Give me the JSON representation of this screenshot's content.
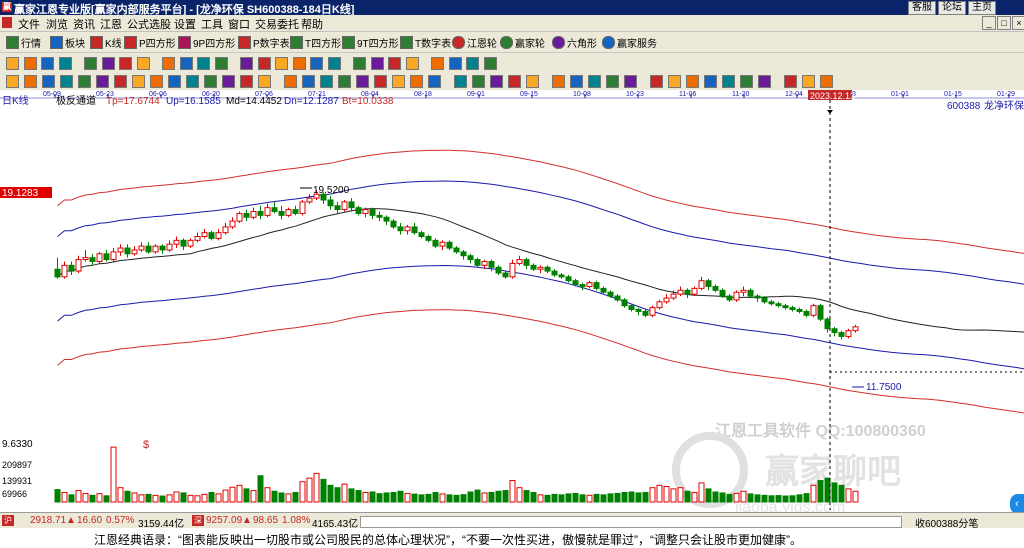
{
  "titlebar": {
    "title": "赢家江恩专业版[赢家内部服务平台] - [龙净环保   SH600388-184日K线]",
    "app_icon": "赢",
    "links": [
      "客服",
      "论坛",
      "主页"
    ],
    "window_buttons": [
      "_",
      "□",
      "×"
    ]
  },
  "menu": [
    "文件",
    "浏览",
    "资讯",
    "江恩",
    "公式选股",
    "设置",
    "工具",
    "窗口",
    "交易委托",
    "帮助"
  ],
  "toolbar1": [
    {
      "label": "行情",
      "icon": "grid-icon",
      "color": "#2e7d32"
    },
    {
      "label": "板块",
      "icon": "blocks-icon",
      "color": "#1565c0"
    },
    {
      "label": "K线",
      "icon": "candle-icon",
      "color": "#c62828"
    },
    {
      "label": "P四方形",
      "icon": "p-square-icon",
      "color": "#c62828"
    },
    {
      "label": "9P四方形",
      "icon": "9p-square-icon",
      "color": "#ad1457"
    },
    {
      "label": "P数字表",
      "icon": "p-number-icon",
      "color": "#c62828"
    },
    {
      "label": "T四方形",
      "icon": "t-square-icon",
      "color": "#2e7d32"
    },
    {
      "label": "9T四方形",
      "icon": "9t-square-icon",
      "color": "#2e7d32"
    },
    {
      "label": "T数字表",
      "icon": "t-number-icon",
      "color": "#2e7d32"
    },
    {
      "label": "江恩轮",
      "icon": "gann-wheel-icon",
      "color": "#c62828"
    },
    {
      "label": "赢家轮",
      "icon": "winner-wheel-icon",
      "color": "#2e7d32"
    },
    {
      "label": "六角形",
      "icon": "hexagon-icon",
      "color": "#6a1b9a"
    },
    {
      "label": "赢家服务",
      "icon": "service-icon",
      "color": "#1565c0"
    }
  ],
  "chart_header": {
    "period": "日K线",
    "indicator": "极反通道",
    "tp": "Tp=17.6744",
    "up": "Up=16.1585",
    "md": "Md=14.4452",
    "dn": "Dn=12.1287",
    "bt": "Bt=10.0338",
    "stock_code": "600388",
    "stock_name": "龙净环保",
    "cursor_date": "2023.12.13",
    "price_tag": "19.1283",
    "high_label": "19.5200",
    "low_label": "11.7500",
    "vol_top": "9.6330",
    "vol_ticks": [
      "209897",
      "139931",
      "69966"
    ],
    "watermark1": "江恩工具软件 QQ:100800360",
    "watermark2": "赢家聊吧",
    "watermark3": "jiaoba.yjgs.com"
  },
  "date_ticks": [
    "05-09",
    "05-23",
    "06-06",
    "06-20",
    "07-06",
    "07-21",
    "08-04",
    "08-18",
    "09-01",
    "09-15",
    "10-08",
    "10-23",
    "11-06",
    "11-20",
    "12-04",
    "12-18",
    "01-01",
    "01-15",
    "01-29"
  ],
  "status": {
    "sh_index": "2918.71",
    "sh_change": "16.60",
    "sh_pct": "0.57%",
    "sh_amount": "3159.44亿",
    "sz_index": "9257.09",
    "sz_change": "98.65",
    "sz_pct": "1.08%",
    "sz_amount": "4165.43亿",
    "right": "收600388分笔"
  },
  "quote": "江恩经典语录：“图表能反映出一切股市或公司股民的总体心理状况”，“不要一次性买进，傲慢就是罪过”，“调整只会让股市更加健康”。",
  "colors": {
    "up_candle": "#e00000",
    "down_candle": "#008000",
    "outer_band": "#d32f2f",
    "inner_band": "#1a1aaa",
    "mid_line": "#222222"
  },
  "chart_data": {
    "type": "candlestick",
    "title": "龙净环保 600388 日K线",
    "ylim": [
      9.633,
      19.52
    ],
    "volume_ylim": [
      0,
      260000
    ],
    "bars": [
      [
        15.4,
        15.0,
        16.0,
        14.9,
        52000
      ],
      [
        15.0,
        15.6,
        15.8,
        14.9,
        40000
      ],
      [
        15.6,
        15.3,
        15.8,
        15.1,
        30000
      ],
      [
        15.3,
        15.9,
        16.1,
        15.2,
        48000
      ],
      [
        15.9,
        16.0,
        16.4,
        15.8,
        36000
      ],
      [
        16.0,
        15.8,
        16.2,
        15.6,
        28000
      ],
      [
        15.8,
        16.2,
        16.3,
        15.7,
        35000
      ],
      [
        16.2,
        15.9,
        16.4,
        15.8,
        26000
      ],
      [
        15.9,
        16.3,
        16.5,
        15.8,
        230000
      ],
      [
        16.3,
        16.5,
        16.7,
        16.1,
        60000
      ],
      [
        16.5,
        16.2,
        16.7,
        16.0,
        45000
      ],
      [
        16.2,
        16.4,
        16.6,
        16.1,
        38000
      ],
      [
        16.4,
        16.6,
        16.8,
        16.3,
        30000
      ],
      [
        16.6,
        16.3,
        16.8,
        16.2,
        32000
      ],
      [
        16.3,
        16.6,
        16.7,
        16.2,
        28000
      ],
      [
        16.6,
        16.4,
        16.7,
        16.2,
        25000
      ],
      [
        16.4,
        16.7,
        16.9,
        16.3,
        30000
      ],
      [
        16.7,
        16.9,
        17.1,
        16.5,
        42000
      ],
      [
        16.9,
        16.6,
        17.0,
        16.4,
        38000
      ],
      [
        16.6,
        16.9,
        17.0,
        16.5,
        28000
      ],
      [
        16.9,
        17.1,
        17.3,
        16.8,
        26000
      ],
      [
        17.1,
        17.3,
        17.5,
        17.0,
        32000
      ],
      [
        17.3,
        17.0,
        17.4,
        16.9,
        40000
      ],
      [
        17.0,
        17.3,
        17.5,
        16.9,
        34000
      ],
      [
        17.3,
        17.6,
        17.8,
        17.2,
        50000
      ],
      [
        17.6,
        17.9,
        18.1,
        17.5,
        62000
      ],
      [
        17.9,
        18.3,
        18.4,
        17.8,
        70000
      ],
      [
        18.3,
        18.1,
        18.5,
        17.9,
        55000
      ],
      [
        18.1,
        18.4,
        18.6,
        18.0,
        48000
      ],
      [
        18.4,
        18.2,
        18.7,
        18.0,
        110000
      ],
      [
        18.2,
        18.6,
        18.8,
        18.1,
        60000
      ],
      [
        18.6,
        18.4,
        18.9,
        18.3,
        45000
      ],
      [
        18.4,
        18.2,
        18.7,
        18.0,
        38000
      ],
      [
        18.2,
        18.5,
        18.6,
        18.1,
        34000
      ],
      [
        18.5,
        18.3,
        18.7,
        18.2,
        40000
      ],
      [
        18.3,
        18.9,
        19.0,
        18.2,
        85000
      ],
      [
        18.9,
        19.1,
        19.3,
        18.8,
        100000
      ],
      [
        19.1,
        19.3,
        19.52,
        19.0,
        120000
      ],
      [
        19.3,
        19.0,
        19.4,
        18.8,
        95000
      ],
      [
        19.0,
        18.7,
        19.2,
        18.5,
        70000
      ],
      [
        18.7,
        18.5,
        18.9,
        18.3,
        60000
      ],
      [
        18.5,
        18.9,
        19.0,
        18.4,
        75000
      ],
      [
        18.9,
        18.6,
        19.1,
        18.4,
        55000
      ],
      [
        18.6,
        18.3,
        18.7,
        18.2,
        48000
      ],
      [
        18.3,
        18.5,
        18.6,
        18.1,
        40000
      ],
      [
        18.5,
        18.2,
        18.6,
        18.0,
        42000
      ],
      [
        18.2,
        18.1,
        18.4,
        17.9,
        35000
      ],
      [
        18.1,
        17.9,
        18.2,
        17.7,
        38000
      ],
      [
        17.9,
        17.6,
        18.0,
        17.5,
        40000
      ],
      [
        17.6,
        17.4,
        17.8,
        17.2,
        45000
      ],
      [
        17.4,
        17.6,
        17.7,
        17.2,
        36000
      ],
      [
        17.6,
        17.3,
        17.8,
        17.2,
        33000
      ],
      [
        17.3,
        17.1,
        17.4,
        17.0,
        30000
      ],
      [
        17.1,
        16.9,
        17.2,
        16.8,
        32000
      ],
      [
        16.9,
        16.6,
        17.0,
        16.5,
        40000
      ],
      [
        16.6,
        16.8,
        16.9,
        16.4,
        34000
      ],
      [
        16.8,
        16.5,
        16.9,
        16.4,
        30000
      ],
      [
        16.5,
        16.3,
        16.6,
        16.2,
        28000
      ],
      [
        16.3,
        16.1,
        16.4,
        15.9,
        31000
      ],
      [
        16.1,
        15.9,
        16.2,
        15.7,
        42000
      ],
      [
        15.9,
        15.6,
        16.0,
        15.5,
        50000
      ],
      [
        15.6,
        15.8,
        15.9,
        15.4,
        38000
      ],
      [
        15.8,
        15.5,
        15.9,
        15.3,
        40000
      ],
      [
        15.5,
        15.2,
        15.6,
        15.1,
        45000
      ],
      [
        15.2,
        15.0,
        15.3,
        14.9,
        48000
      ],
      [
        15.0,
        15.7,
        15.9,
        14.9,
        90000
      ],
      [
        15.7,
        15.9,
        16.1,
        15.6,
        60000
      ],
      [
        15.9,
        15.6,
        16.0,
        15.4,
        48000
      ],
      [
        15.6,
        15.4,
        15.7,
        15.3,
        40000
      ],
      [
        15.4,
        15.5,
        15.6,
        15.2,
        30000
      ],
      [
        15.5,
        15.3,
        15.6,
        15.2,
        28000
      ],
      [
        15.3,
        15.1,
        15.4,
        15.0,
        32000
      ],
      [
        15.1,
        15.0,
        15.2,
        14.9,
        30000
      ],
      [
        15.0,
        14.8,
        15.1,
        14.7,
        34000
      ],
      [
        14.8,
        14.6,
        14.9,
        14.5,
        36000
      ],
      [
        14.6,
        14.5,
        14.7,
        14.3,
        30000
      ],
      [
        14.5,
        14.7,
        14.8,
        14.4,
        28000
      ],
      [
        14.7,
        14.4,
        14.8,
        14.3,
        32000
      ],
      [
        14.4,
        14.2,
        14.5,
        14.1,
        30000
      ],
      [
        14.2,
        14.0,
        14.3,
        13.9,
        34000
      ],
      [
        14.0,
        13.8,
        14.1,
        13.7,
        36000
      ],
      [
        13.8,
        13.5,
        13.9,
        13.4,
        40000
      ],
      [
        13.5,
        13.3,
        13.6,
        13.2,
        42000
      ],
      [
        13.3,
        13.2,
        13.4,
        13.0,
        38000
      ],
      [
        13.2,
        13.0,
        13.3,
        12.9,
        40000
      ],
      [
        13.0,
        13.4,
        13.5,
        12.9,
        60000
      ],
      [
        13.4,
        13.7,
        13.8,
        13.3,
        70000
      ],
      [
        13.7,
        13.9,
        14.1,
        13.6,
        65000
      ],
      [
        13.9,
        14.1,
        14.3,
        13.8,
        55000
      ],
      [
        14.1,
        14.3,
        14.5,
        14.0,
        60000
      ],
      [
        14.3,
        14.1,
        14.4,
        13.9,
        45000
      ],
      [
        14.1,
        14.4,
        14.5,
        14.0,
        40000
      ],
      [
        14.4,
        14.8,
        15.0,
        14.3,
        80000
      ],
      [
        14.8,
        14.5,
        14.9,
        14.3,
        55000
      ],
      [
        14.5,
        14.3,
        14.6,
        14.2,
        42000
      ],
      [
        14.3,
        14.0,
        14.4,
        13.9,
        38000
      ],
      [
        14.0,
        13.8,
        14.1,
        13.7,
        32000
      ],
      [
        13.8,
        14.2,
        14.3,
        13.7,
        36000
      ],
      [
        14.2,
        14.3,
        14.5,
        14.0,
        45000
      ],
      [
        14.3,
        14.0,
        14.4,
        13.9,
        34000
      ],
      [
        14.0,
        13.9,
        14.1,
        13.7,
        30000
      ],
      [
        13.9,
        13.7,
        14.0,
        13.6,
        28000
      ],
      [
        13.7,
        13.6,
        13.8,
        13.5,
        26000
      ],
      [
        13.6,
        13.5,
        13.7,
        13.4,
        27000
      ],
      [
        13.5,
        13.4,
        13.6,
        13.3,
        25000
      ],
      [
        13.4,
        13.3,
        13.5,
        13.2,
        26000
      ],
      [
        13.3,
        13.2,
        13.4,
        13.1,
        30000
      ],
      [
        13.2,
        13.0,
        13.3,
        12.9,
        35000
      ],
      [
        13.0,
        13.5,
        13.6,
        12.9,
        70000
      ],
      [
        13.5,
        12.8,
        13.6,
        12.7,
        90000
      ],
      [
        12.8,
        12.3,
        12.9,
        12.1,
        100000
      ],
      [
        12.3,
        12.1,
        12.4,
        11.9,
        80000
      ],
      [
        12.1,
        11.9,
        12.2,
        11.75,
        70000
      ],
      [
        11.9,
        12.2,
        12.3,
        11.8,
        55000
      ],
      [
        12.2,
        12.4,
        12.5,
        12.1,
        45000
      ]
    ]
  }
}
